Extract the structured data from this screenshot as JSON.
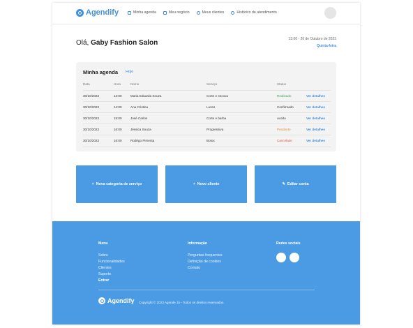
{
  "brand": {
    "name": "Agendify",
    "color": "#3f8fe0"
  },
  "nav": [
    {
      "label": "Minha agenda",
      "icon": "calendar-icon"
    },
    {
      "label": "Meu negócio",
      "icon": "store-icon"
    },
    {
      "label": "Meus clientes",
      "icon": "users-icon"
    },
    {
      "label": "Histórico de atendimento",
      "icon": "history-icon"
    }
  ],
  "greeting": {
    "prefix": "Olá,",
    "name": "Gaby Fashion Salon"
  },
  "datetime": {
    "line": "13:00 - 26 de Outubro de 2023",
    "weekday": "Quinta-feira"
  },
  "agenda": {
    "title": "Minha agenda",
    "link": "Hoje",
    "columns": [
      "Data",
      "Hora",
      "Nome",
      "Serviço",
      "Status"
    ],
    "rows": [
      {
        "data": "30/10/2023",
        "hora": "12:00",
        "nome": "Maria Eduarda Souza",
        "servico": "Corte e escova",
        "status": "Realizado",
        "status_color": "#3aa655",
        "link": "Ver detalhes"
      },
      {
        "data": "30/10/2023",
        "hora": "14:00",
        "nome": "Ana Cristina",
        "servico": "Luzes",
        "status": "Confirmado",
        "status_color": "#333333",
        "link": "Ver detalhes"
      },
      {
        "data": "30/10/2023",
        "hora": "15:00",
        "nome": "José Carlos",
        "servico": "Corte e barba",
        "status": "Aceito",
        "status_color": "#333333",
        "link": "Ver detalhes"
      },
      {
        "data": "30/10/2023",
        "hora": "16:00",
        "nome": "Jéssica Souza",
        "servico": "Progressiva",
        "status": "Pendente",
        "status_color": "#f08a24",
        "link": "Ver detalhes"
      },
      {
        "data": "30/10/2023",
        "hora": "16:00",
        "nome": "Rodrigo Pimenta",
        "servico": "Botox",
        "status": "Cancelado",
        "status_color": "#e5533d",
        "link": "Ver detalhes"
      }
    ]
  },
  "actions": [
    {
      "label": "Nova categoria de serviço",
      "icon": "plus-icon",
      "glyph": "+"
    },
    {
      "label": "Novo cliente",
      "icon": "plus-icon",
      "glyph": "+"
    },
    {
      "label": "Editar conta",
      "icon": "pencil-icon",
      "glyph": "✎"
    }
  ],
  "footer": {
    "menu": {
      "title": "Menu",
      "links": [
        "Sobre",
        "Funcionalidades",
        "Clientes",
        "Suporte"
      ],
      "strong_link": "Entrar"
    },
    "info": {
      "title": "Informação",
      "links": [
        "Perguntas frequentes",
        "Definição de cookies",
        "Contato"
      ]
    },
    "social": {
      "title": "Redes sociais"
    },
    "brand": "Agendify",
    "copyright": "Copyright © 2023 Agende Já - Todos os direitos reservados."
  }
}
